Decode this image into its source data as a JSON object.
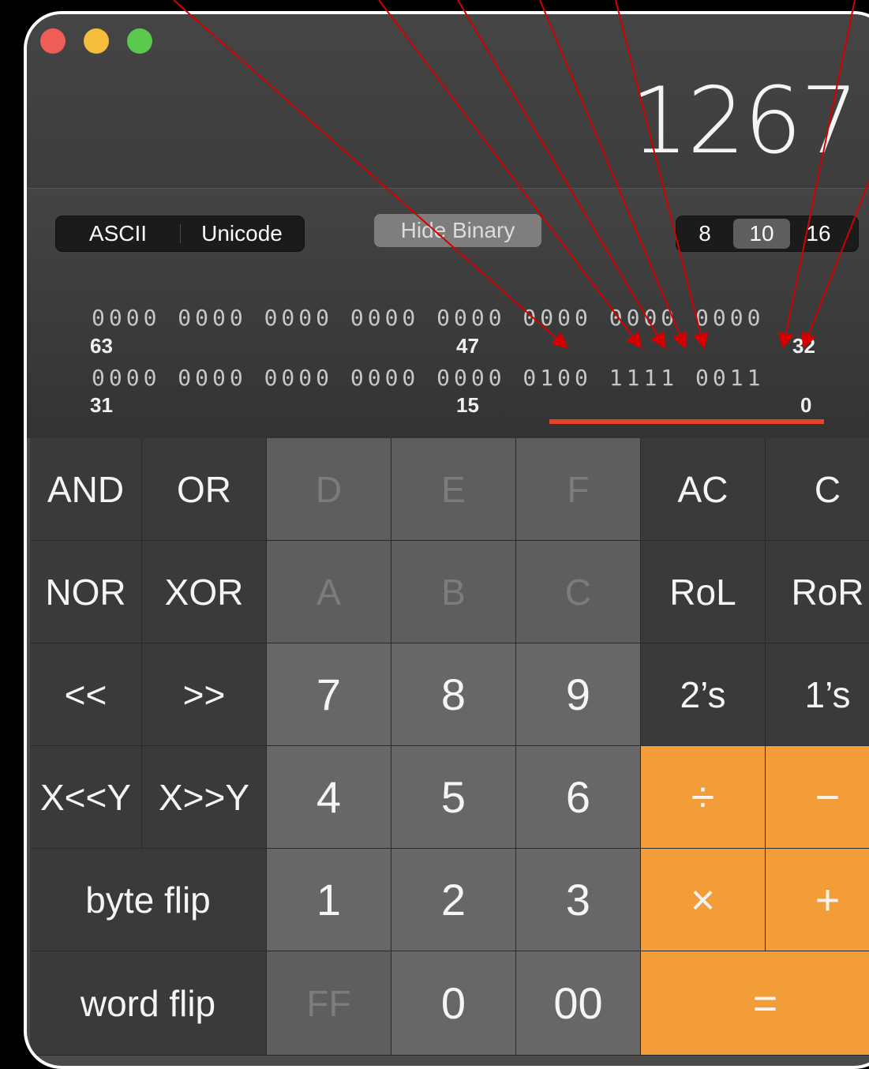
{
  "window": {
    "traffic_lights": [
      "close",
      "minimize",
      "maximize"
    ]
  },
  "display": {
    "value": "1267"
  },
  "toolbar": {
    "encoding": {
      "options": [
        "ASCII",
        "Unicode"
      ]
    },
    "hide_binary_label": "Hide Binary",
    "base": {
      "options": [
        "8",
        "10",
        "16"
      ],
      "selected": "10"
    }
  },
  "binary": {
    "row1": "0000 0000 0000 0000 0000 0000 0000 0000",
    "row2": "0000 0000 0000 0000 0000 0100 1111 0011",
    "labels": {
      "b63": "63",
      "b47": "47",
      "b32": "32",
      "b31": "31",
      "b15": "15",
      "b0": "0"
    }
  },
  "keypad": {
    "rows": [
      [
        "AND",
        "OR",
        "D",
        "E",
        "F",
        "AC",
        "C"
      ],
      [
        "NOR",
        "XOR",
        "A",
        "B",
        "C",
        "RoL",
        "RoR"
      ],
      [
        "<<",
        ">>",
        "7",
        "8",
        "9",
        "2’s",
        "1’s"
      ],
      [
        "X<<Y",
        "X>>Y",
        "4",
        "5",
        "6",
        "÷",
        "−"
      ],
      [
        "byte flip",
        "1",
        "2",
        "3",
        "×",
        "+"
      ],
      [
        "word flip",
        "FF",
        "0",
        "00",
        "="
      ]
    ]
  },
  "colors": {
    "operator": "#f29d38",
    "annotation": "#d40000",
    "underline": "#e8442a"
  }
}
